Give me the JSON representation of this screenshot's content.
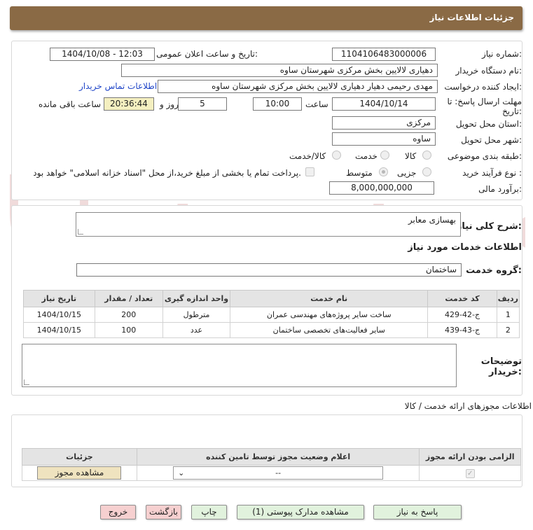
{
  "header": {
    "title": "جزئیات اطلاعات نیاز"
  },
  "fields": {
    "need_number_label": "شماره نیاز:",
    "need_number": "1104106483000006",
    "announce_label": "تاریخ و ساعت اعلان عمومی:",
    "announce_value": "1404/10/08 - 12:03",
    "buyer_org_label": "نام دستگاه خریدار:",
    "buyer_org": "دهیاری لالایین بخش مرکزی شهرستان ساوه",
    "creator_label": "ایجاد کننده درخواست:",
    "creator": "مهدی رحیمی دهیار دهیاری لالایین بخش مرکزی شهرستان ساوه",
    "contact_link": "اطلاعات تماس خریدار",
    "deadline_label_1": "مهلت ارسال پاسخ: تا",
    "deadline_label_2": "تاریخ:",
    "deadline_date": "1404/10/14",
    "time_label": "ساعت",
    "deadline_time": "10:00",
    "days_value": "5",
    "days_label": "روز و",
    "remaining_time": "20:36:44",
    "remaining_label": "ساعت باقی مانده",
    "province_label": "استان محل تحویل:",
    "province": "مرکزی",
    "city_label": "شهر محل تحویل:",
    "city": "ساوه",
    "category_label": "طبقه بندی موضوعی:",
    "category_options": [
      "کالا",
      "خدمت",
      "کالا/خدمت"
    ],
    "process_label": "نوع فرآیند خرید :",
    "process_options": [
      "جزیی",
      "متوسط"
    ],
    "payment_note": "پرداخت تمام یا بخشی از مبلغ خرید،از محل \"اسناد خزانه اسلامی\" خواهد بود.",
    "estimate_label": "برآورد مالی:",
    "estimate": "8,000,000,000"
  },
  "description": {
    "label": "شرح کلی نیاز:",
    "value": "بهسازی معابر"
  },
  "services": {
    "section_title": "اطلاعات خدمات مورد نیاز",
    "group_label": "گروه خدمت:",
    "group_value": "ساختمان",
    "columns": [
      "ردیف",
      "کد خدمت",
      "نام خدمت",
      "واحد اندازه گیری",
      "تعداد / مقدار",
      "تاریخ نیاز"
    ],
    "rows": [
      [
        "1",
        "ج-42-429",
        "ساخت سایر پروژه‌های مهندسی عمران",
        "مترطول",
        "200",
        "1404/10/15"
      ],
      [
        "2",
        "ج-43-439",
        "سایر فعالیت‌های تخصصی ساختمان",
        "عدد",
        "100",
        "1404/10/15"
      ]
    ]
  },
  "buyer_notes": {
    "label_1": "توضیحات",
    "label_2": "خریدار:"
  },
  "permits": {
    "section_title": "اطلاعات مجوزهای ارائه خدمت / کالا",
    "columns": [
      "الزامی بودن ارائه مجوز",
      "اعلام وضعیت مجوز توسط تامین کننده",
      "جزئیات"
    ],
    "select_value": "--",
    "view_button": "مشاهده مجوز"
  },
  "buttons": {
    "reply": "پاسخ به نیاز",
    "attachments": "مشاهده مدارک پیوستی (1)",
    "print": "چاپ",
    "back": "بازگشت",
    "exit": "خروج"
  },
  "watermark_text": "AriaTender.neT",
  "colors": {
    "header": "#8a6a45",
    "link": "#2046c8",
    "remaining_bg": "#f4efc0"
  }
}
